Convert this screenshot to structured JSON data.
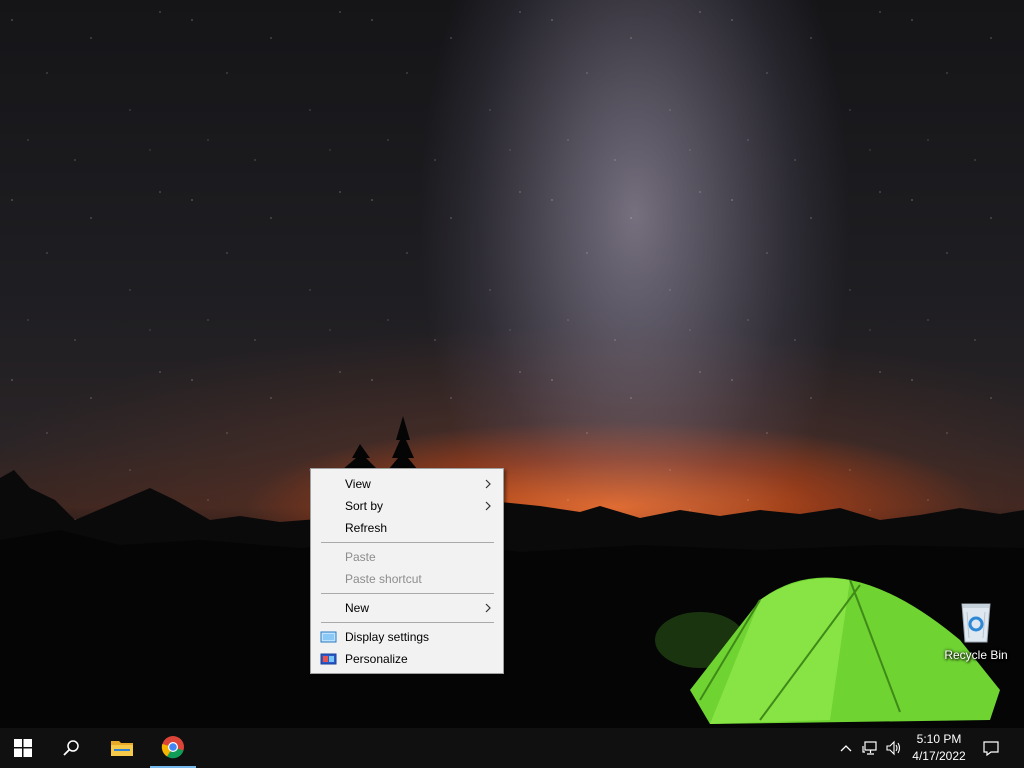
{
  "context_menu": {
    "items": [
      {
        "label": "View",
        "has_submenu": true,
        "enabled": true
      },
      {
        "label": "Sort by",
        "has_submenu": true,
        "enabled": true
      },
      {
        "label": "Refresh",
        "has_submenu": false,
        "enabled": true
      },
      {
        "label": "Paste",
        "has_submenu": false,
        "enabled": false
      },
      {
        "label": "Paste shortcut",
        "has_submenu": false,
        "enabled": false
      },
      {
        "label": "New",
        "has_submenu": true,
        "enabled": true
      },
      {
        "label": "Display settings",
        "icon": "display-icon",
        "enabled": true
      },
      {
        "label": "Personalize",
        "icon": "personalize-icon",
        "enabled": true
      }
    ]
  },
  "desktop_icons": {
    "recycle_bin": {
      "label": "Recycle Bin",
      "icon": "recycle-bin-icon"
    }
  },
  "taskbar": {
    "start_icon": "windows-logo-icon",
    "search_icon": "search-icon",
    "apps": [
      {
        "name": "File Explorer",
        "icon": "folder-icon"
      },
      {
        "name": "Google Chrome",
        "icon": "chrome-icon",
        "active": true
      }
    ],
    "tray": {
      "time": "5:10 PM",
      "date": "4/17/2022",
      "icons": [
        "chevron-up-icon",
        "network-icon",
        "volume-icon",
        "notification-icon"
      ]
    }
  },
  "colors": {
    "menu_bg": "#f2f2f2",
    "taskbar_bg": "#101010",
    "active_indicator": "#76b9ed",
    "tent_green": "#7be03a"
  }
}
